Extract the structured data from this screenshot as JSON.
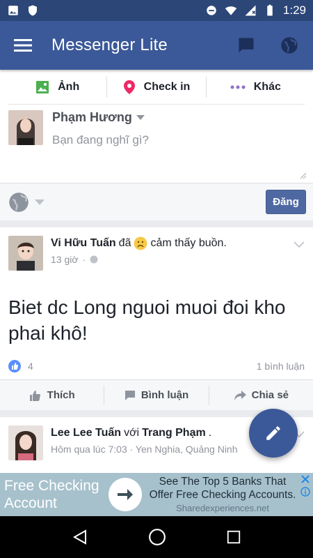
{
  "status_bar": {
    "time": "1:29"
  },
  "app_bar": {
    "title": "Messenger Lite"
  },
  "composer": {
    "tabs": [
      {
        "label": "Ảnh",
        "icon": "photo-icon"
      },
      {
        "label": "Check in",
        "icon": "location-pin-icon"
      },
      {
        "label": "Khác",
        "icon": "more-dots-icon"
      }
    ],
    "user_name": "Phạm Hương",
    "placeholder": "Bạn đang nghĩ gì?",
    "post_button": "Đăng"
  },
  "posts": [
    {
      "author": "Vi Hữu Tuấn",
      "feeling_prefix": "đã",
      "feeling": "cảm thấy buồn.",
      "time": "13 giờ",
      "body": "Biet dc Long nguoi muoi đoi kho phai khô!",
      "likes": "4",
      "comments": "1 bình luận"
    },
    {
      "author": "Lee Lee Tuấn",
      "with_word": "với",
      "with_name": "Trang Phạm",
      "time_location": "Hôm qua lúc 7:03 · Yen Nghia, Quảng Ninh"
    }
  ],
  "post_actions": {
    "like": "Thích",
    "comment": "Bình luận",
    "share": "Chia sẻ"
  },
  "ad": {
    "left_text": "Free Checking Account",
    "right_text": "See The Top 5 Banks That Offer Free Checking Accounts.",
    "source": "Sharedexperiences.net"
  },
  "colors": {
    "brand": "#3b5998",
    "status_bar": "#2c4678",
    "ad_bg": "#a7c1cc"
  }
}
